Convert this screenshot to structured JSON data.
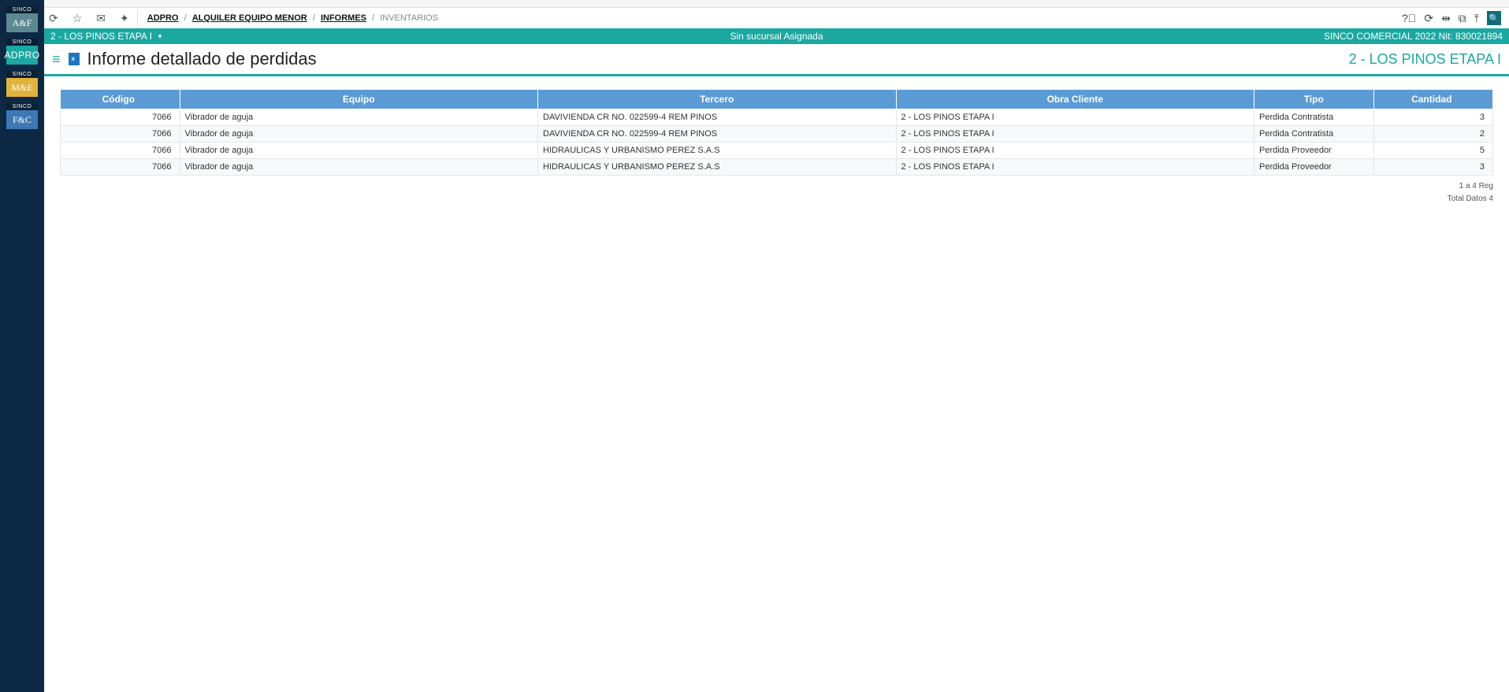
{
  "sidebar": {
    "brand_top": "SINCO",
    "items": [
      {
        "main": "A&F",
        "cls": "brand-af"
      },
      {
        "main": "ADPRO",
        "cls": "brand-adpro"
      },
      {
        "main": "M&E",
        "cls": "brand-me"
      },
      {
        "main": "F&C",
        "cls": "brand-fc"
      }
    ]
  },
  "breadcrumb": {
    "items": [
      {
        "label": "ADPRO",
        "link": true
      },
      {
        "label": "ALQUILER EQUIPO MENOR",
        "link": true
      },
      {
        "label": "INFORMES",
        "link": true
      },
      {
        "label": "INVENTARIOS",
        "link": false
      }
    ]
  },
  "project_bar": {
    "left": "2 - LOS PINOS ETAPA I",
    "center": "Sin sucursal Asignada",
    "right": "SINCO COMERCIAL 2022 Nit: 830021894"
  },
  "title_bar": {
    "title": "Informe detallado de perdidas",
    "right": "2 - LOS PINOS ETAPA I"
  },
  "table": {
    "headers": [
      "Código",
      "Equipo",
      "Tercero",
      "Obra Cliente",
      "Tipo",
      "Cantidad"
    ],
    "rows": [
      {
        "codigo": "7066",
        "equipo": "Vibrador de aguja",
        "tercero": "DAVIVIENDA CR NO. 022599-4 REM PINOS",
        "obra": "2 - LOS PINOS ETAPA I",
        "tipo": "Perdida Contratista",
        "cantidad": "3"
      },
      {
        "codigo": "7066",
        "equipo": "Vibrador de aguja",
        "tercero": "DAVIVIENDA CR NO. 022599-4 REM PINOS",
        "obra": "2 - LOS PINOS ETAPA I",
        "tipo": "Perdida Contratista",
        "cantidad": "2"
      },
      {
        "codigo": "7066",
        "equipo": "Vibrador de aguja",
        "tercero": "HIDRAULICAS Y URBANISMO PEREZ S.A.S",
        "obra": "2 - LOS PINOS ETAPA I",
        "tipo": "Perdida Proveedor",
        "cantidad": "5"
      },
      {
        "codigo": "7066",
        "equipo": "Vibrador de aguja",
        "tercero": "HIDRAULICAS Y URBANISMO PEREZ S.A.S",
        "obra": "2 - LOS PINOS ETAPA I",
        "tipo": "Perdida Proveedor",
        "cantidad": "3"
      }
    ],
    "footer_range": "1 a 4 Reg",
    "footer_total": "Total Datos 4"
  }
}
